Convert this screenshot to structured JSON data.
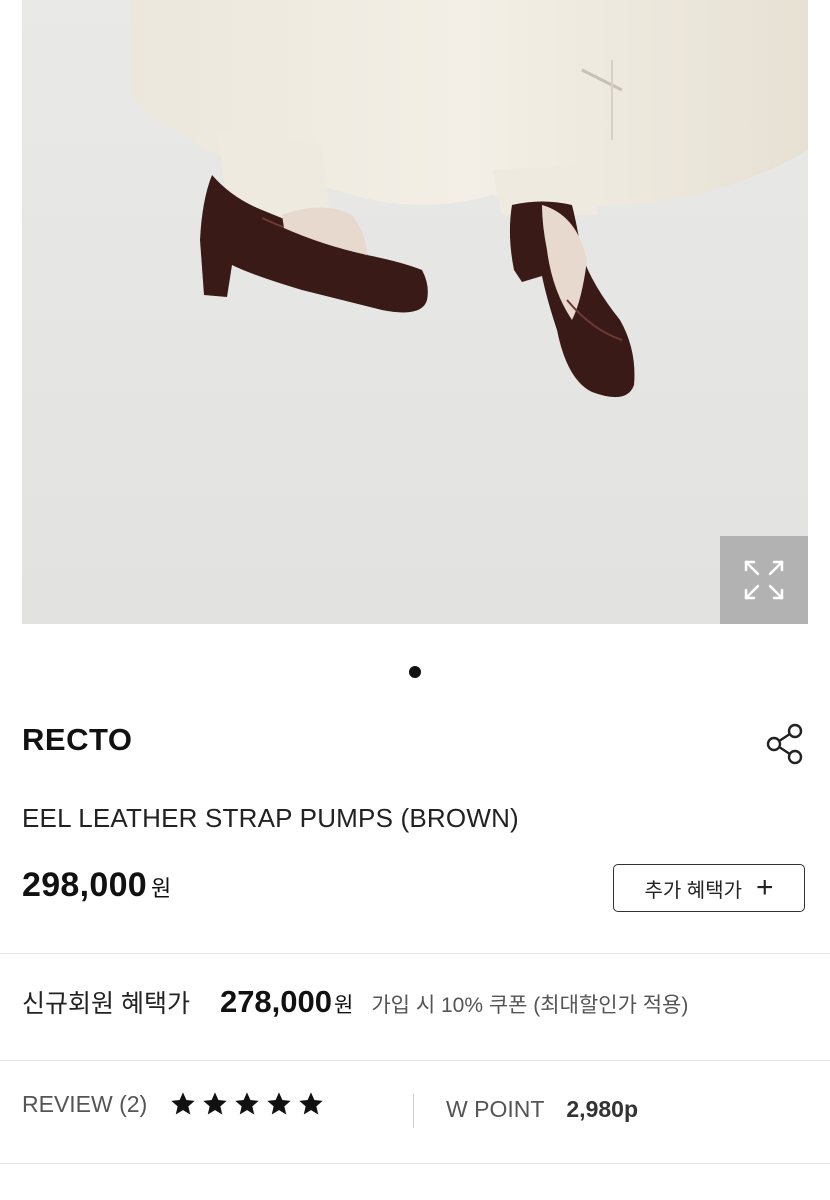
{
  "gallery": {
    "image_icon": "product-photo",
    "zoom_icon": "expand-icon",
    "page_indicator_count": 1,
    "active_index": 0
  },
  "product": {
    "brand": "RECTO",
    "name": "EEL LEATHER STRAP PUMPS (BROWN)",
    "price": "298,000",
    "currency": "원",
    "share_icon": "share-icon",
    "benefit_button_label": "추가 혜택가",
    "benefit_button_icon": "plus-icon"
  },
  "member_benefit": {
    "label": "신규회원 혜택가",
    "price": "278,000",
    "currency": "원",
    "note": "가입 시 10% 쿠폰 (최대할인가 적용)"
  },
  "review": {
    "label": "REVIEW (2)",
    "rating": 5,
    "max_rating": 5
  },
  "points": {
    "label": "W POINT",
    "value": "2,980p"
  },
  "colors": {
    "text": "#111111",
    "muted": "#555555",
    "divider": "#e3e3e3",
    "shoe": "#3a1a16"
  }
}
